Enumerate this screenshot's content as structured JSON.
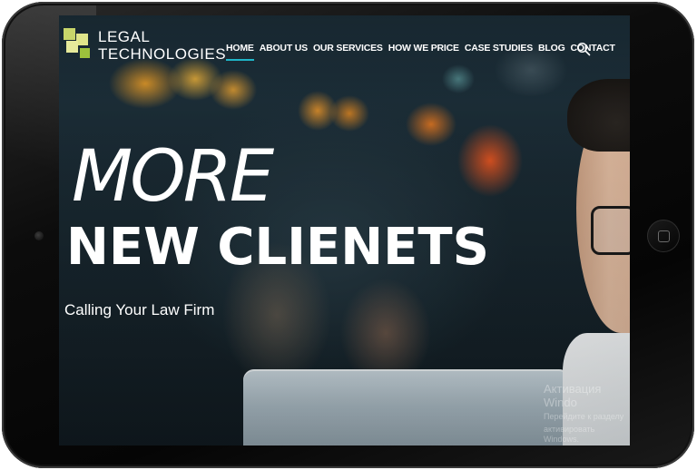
{
  "colors": {
    "accent": "#1fb6c9",
    "logo_squares": [
      "#c8d66a",
      "#dfe58a",
      "#e6ea9b",
      "#9cc23c"
    ]
  },
  "header": {
    "logo_line1": "LEGAL",
    "logo_line2": "TECHNOLOGIES",
    "nav": [
      {
        "label": "HOME",
        "active": true
      },
      {
        "label": "ABOUT US"
      },
      {
        "label": "OUR SERVICES"
      },
      {
        "label": "HOW WE PRICE"
      },
      {
        "label": "CASE STUDIES"
      },
      {
        "label": "BLOG"
      },
      {
        "label": "CONTACT"
      }
    ],
    "search_icon": "search-icon"
  },
  "hero": {
    "line1": "MORE",
    "line2": "NEW CLIENETS",
    "subtitle": "Calling Your Law Firm"
  },
  "watermark": {
    "line1": "Активация Windo",
    "line2": "Перейдите к разделу",
    "line3": "активировать Windows."
  },
  "device": {
    "home_button_icon": "home-button-icon",
    "camera_icon": "camera-icon"
  }
}
